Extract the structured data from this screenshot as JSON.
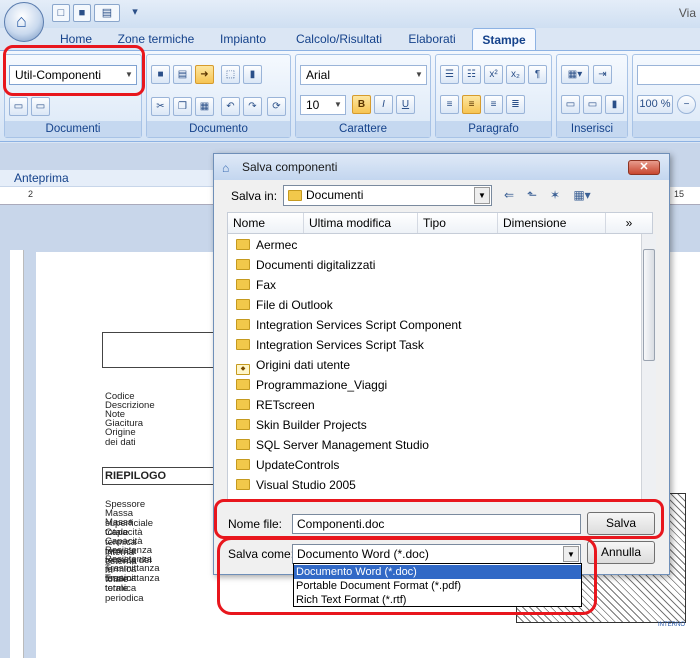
{
  "app": {
    "title": "Via",
    "home_icon": "home-orb-icon"
  },
  "quick_access": [
    {
      "icon": "new-document-icon",
      "glyph": "□"
    },
    {
      "icon": "save-icon",
      "glyph": "■"
    },
    {
      "icon": "print-settings-icon",
      "glyph": "▤"
    },
    {
      "icon": "customize-quick-access-icon",
      "glyph": "▾"
    }
  ],
  "tabs": [
    "Home",
    "Zone termiche",
    "Impianto",
    "Calcolo/Risultati",
    "Elaborati",
    "Stampe"
  ],
  "active_tab": "Stampe",
  "ribbon": {
    "documenti": {
      "label": "Documenti",
      "selector_value": "Util-Componenti"
    },
    "documento": {
      "label": "Documento"
    },
    "carattere": {
      "label": "Carattere",
      "font": "Arial",
      "size": "10",
      "bold": "B",
      "italic": "I",
      "underline": "U"
    },
    "paragrafo": {
      "label": "Paragrafo",
      "superscript": "x²",
      "subscript": "x₂",
      "pilcrow": "¶"
    },
    "inserisci": {
      "label": "Inserisci"
    },
    "zoom": {
      "value": "100 %"
    }
  },
  "preview": {
    "label": "Anteprima"
  },
  "ruler": {
    "start": "2",
    "end": "15"
  },
  "document": {
    "fields": [
      "Codice",
      "Descrizione",
      "Note",
      "Giacitura",
      "Origine dei dati"
    ],
    "summary_title": "RIEPILOGO",
    "summary_rows": [
      "Spessore",
      "Massa superficiale",
      "Massa totale",
      "Capacità termica interna",
      "Capacità termica esterna",
      "Resistenza termica dei m",
      "Resistenza termica totale",
      "Trasmittanza termica totale",
      "Trasmittanza termica periodica"
    ],
    "section_label": "INTERNO"
  },
  "dialog": {
    "title": "Salva componenti",
    "save_in_label": "Salva in:",
    "save_in_value": "Documenti",
    "columns": [
      "Nome",
      "Ultima modifica",
      "Tipo",
      "Dimensione"
    ],
    "more_columns": "»",
    "items": [
      "Aermec",
      "Documenti digitalizzati",
      "Fax",
      "File di Outlook",
      "Integration Services Script Component",
      "Integration Services Script Task",
      "Origini dati utente",
      "Programmazione_Viaggi",
      "RETscreen",
      "Skin Builder Projects",
      "SQL Server Management Studio",
      "UpdateControls",
      "Visual Studio 2005"
    ],
    "special_item": "Origini dati utente",
    "filename_label": "Nome file:",
    "filename_value": "Componenti.doc",
    "save_button": "Salva",
    "save_as_label": "Salva come:",
    "save_as_value": "Documento Word (*.doc)",
    "cancel_button": "Annulla",
    "type_options": [
      "Documento Word (*.doc)",
      "Portable Document Format (*.pdf)",
      "Rich Text Format (*.rtf)"
    ],
    "selected_option": 0
  },
  "colors": {
    "accent": "#15428b",
    "highlight": "#e8161d",
    "selection": "#3169c6",
    "folder": "#f2c84b"
  }
}
